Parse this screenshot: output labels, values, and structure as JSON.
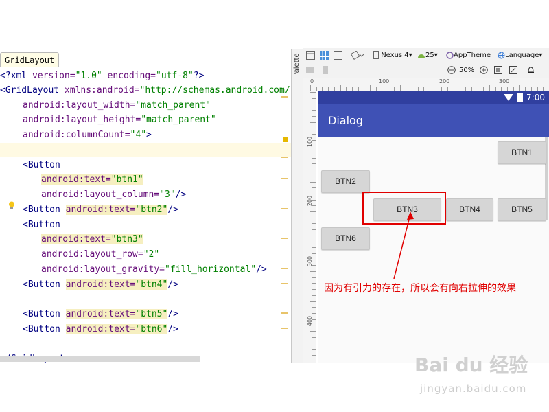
{
  "breadcrumb": "GridLayout",
  "palette": {
    "label": "Palette"
  },
  "toolbar": {
    "device": "Nexus 4",
    "api": "25",
    "theme": "AppTheme",
    "language": "Language",
    "zoom": "50%"
  },
  "ruler": {
    "h": [
      "0",
      "100",
      "200",
      "300"
    ],
    "v": [
      "100",
      "200",
      "300",
      "400"
    ]
  },
  "code": [
    {
      "tag_open": "<?",
      "kw": "xml",
      "a1": " version=",
      "v1": "\"1.0\"",
      "a2": " encoding=",
      "v2": "\"utf-8\"",
      "tag_close": "?>"
    },
    {
      "tag": "<GridLayout",
      "attr": " xmlns:android=",
      "val": "\"http://schemas.android.com/"
    },
    {
      "attr": "android:layout_width=",
      "val": "\"match_parent\""
    },
    {
      "attr": "android:layout_height=",
      "val": "\"match_parent\""
    },
    {
      "attr": "android:columnCount=",
      "val": "\"4\"",
      "close": ">"
    },
    {
      "text": ""
    },
    {
      "tag": "<Button"
    },
    {
      "attr": "android:text=",
      "val": "\"btn1\""
    },
    {
      "attr": "android:layout_column=",
      "val": "\"3\"",
      "close": "/>"
    },
    {
      "tag": "<Button",
      "attr": "android:text=",
      "val": "\"btn2\"",
      "close": "/>"
    },
    {
      "tag": "<Button"
    },
    {
      "attr": "android:text=",
      "val": "\"btn3\""
    },
    {
      "attr": "android:layout_row=",
      "val": "\"2\""
    },
    {
      "attr": "android:layout_gravity=",
      "val": "\"fill_horizontal\"",
      "close": "/>"
    },
    {
      "tag": "<Button",
      "attr": "android:text=",
      "val": "\"btn4\"",
      "close": "/>"
    },
    {
      "text": ""
    },
    {
      "tag": "<Button",
      "attr": "android:text=",
      "val": "\"btn5\"",
      "close": "/>"
    },
    {
      "tag": "<Button",
      "attr": "android:text=",
      "val": "\"btn6\"",
      "close": "/>"
    },
    {
      "text": ""
    },
    {
      "tag": "</GridLayout",
      "close": ">"
    }
  ],
  "preview": {
    "time": "7:00",
    "app_title": "Dialog",
    "buttons": [
      "BTN1",
      "BTN2",
      "BTN3",
      "BTN4",
      "BTN5",
      "BTN6"
    ]
  },
  "annotation": "因为有引力的存在，所以会有向右拉伸的效果",
  "watermark": {
    "brand": "Bai du 经验",
    "url": "jingyan.baidu.com"
  },
  "colors": {
    "appbar": "#3f51b5",
    "statusbar": "#303f9f",
    "annotation": "#e00000"
  }
}
